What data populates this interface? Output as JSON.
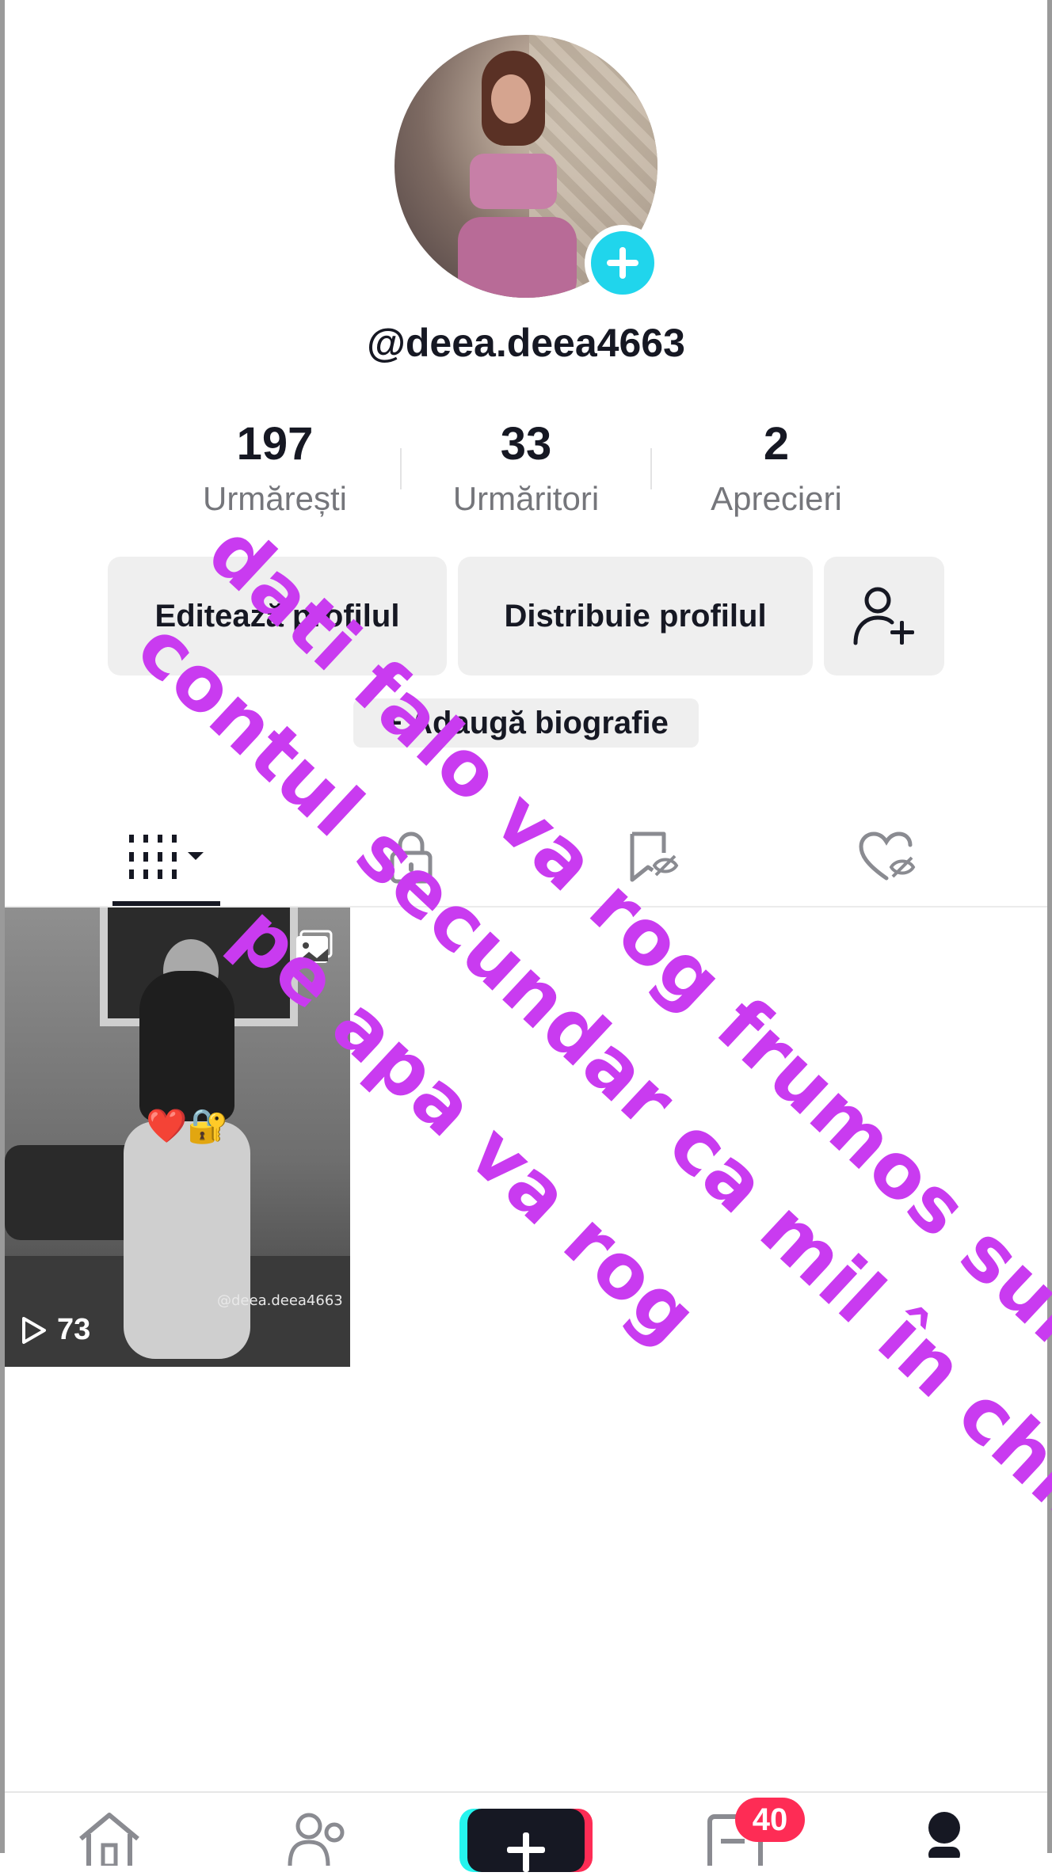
{
  "profile": {
    "username": "@deea.deea4663",
    "avatar_label": "profile-photo"
  },
  "stats": [
    {
      "value": "197",
      "label": "Urmărești"
    },
    {
      "value": "33",
      "label": "Urmăritori"
    },
    {
      "value": "2",
      "label": "Aprecieri"
    }
  ],
  "actions": {
    "edit_profile": "Editează profilul",
    "share_profile": "Distribuie profilul",
    "add_friend_icon": "add-user-icon"
  },
  "bio_button": "+ Adaugă biografie",
  "tabs": [
    {
      "name": "videos",
      "icon": "grid-icon"
    },
    {
      "name": "private",
      "icon": "lock-icon"
    },
    {
      "name": "favorites",
      "icon": "bookmark-hidden-icon"
    },
    {
      "name": "liked",
      "icon": "heart-hidden-icon"
    }
  ],
  "videos": [
    {
      "views": "73",
      "type": "photo",
      "watermark": "@deea.deea4663",
      "emoji": "❤️🔐"
    }
  ],
  "overlay_text": {
    "line1": "dati falo va rog frumos sunt pe",
    "line2": "contul secundar ca mil în chis",
    "line3": "pe apa va rog"
  },
  "bottom_nav": {
    "inbox_badge": "40"
  },
  "colors": {
    "accent_cyan": "#20d5ec",
    "accent_red": "#fe2c55",
    "overlay_purple": "#c93bf0"
  }
}
